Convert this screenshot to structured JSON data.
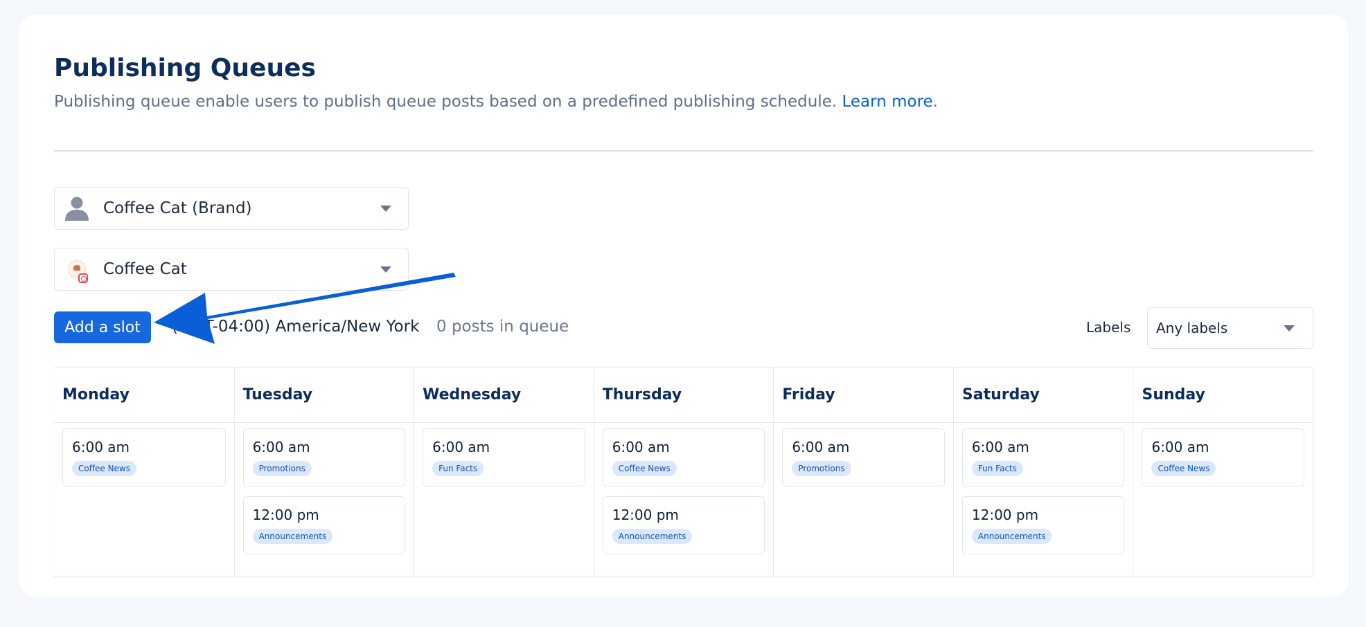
{
  "header": {
    "title": "Publishing Queues",
    "subtitle": "Publishing queue enable users to publish queue posts based on a predefined publishing schedule.",
    "learn_more": "Learn more",
    "period": "."
  },
  "brand_select": {
    "value": "Coffee Cat (Brand)",
    "icon": "user-icon"
  },
  "account_select": {
    "value": "Coffee Cat",
    "icon": "instagram-icon"
  },
  "toolbar": {
    "add_slot": "Add a slot",
    "timezone": "(GMT-04:00) America/New York",
    "queue_count": "0 posts in queue",
    "labels_caption": "Labels",
    "labels_value": "Any labels"
  },
  "colors": {
    "accent": "#1767e0",
    "title": "#0d2d5c",
    "tag_bg": "#dbe8fb",
    "tag_text": "#1250b8",
    "arrow": "#0a5ed7"
  },
  "days": [
    {
      "name": "Monday",
      "slots": [
        {
          "time": "6:00 am",
          "label": "Coffee News"
        }
      ]
    },
    {
      "name": "Tuesday",
      "slots": [
        {
          "time": "6:00 am",
          "label": "Promotions"
        },
        {
          "time": "12:00 pm",
          "label": "Announcements"
        }
      ]
    },
    {
      "name": "Wednesday",
      "slots": [
        {
          "time": "6:00 am",
          "label": "Fun Facts"
        }
      ]
    },
    {
      "name": "Thursday",
      "slots": [
        {
          "time": "6:00 am",
          "label": "Coffee News"
        },
        {
          "time": "12:00 pm",
          "label": "Announcements"
        }
      ]
    },
    {
      "name": "Friday",
      "slots": [
        {
          "time": "6:00 am",
          "label": "Promotions"
        }
      ]
    },
    {
      "name": "Saturday",
      "slots": [
        {
          "time": "6:00 am",
          "label": "Fun Facts"
        },
        {
          "time": "12:00 pm",
          "label": "Announcements"
        }
      ]
    },
    {
      "name": "Sunday",
      "slots": [
        {
          "time": "6:00 am",
          "label": "Coffee News"
        }
      ]
    }
  ]
}
